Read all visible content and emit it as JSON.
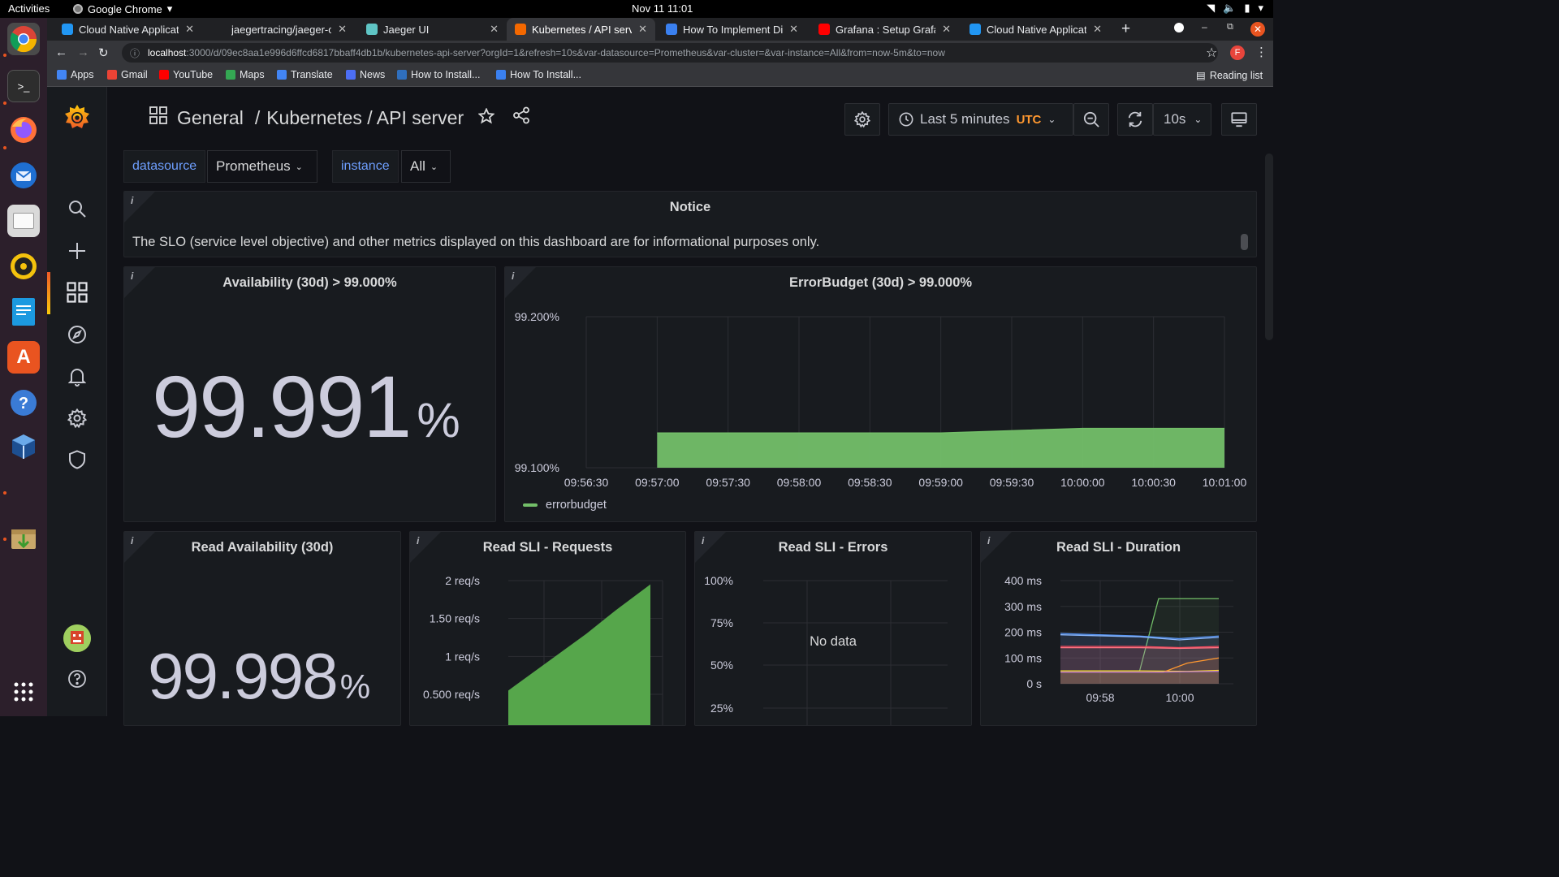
{
  "os": {
    "activities": "Activities",
    "app_name": "Google Chrome",
    "clock": "Nov 11  11:01"
  },
  "browser": {
    "tabs": [
      {
        "title": "Cloud Native Applicatio",
        "favicon_color": "#2196f3"
      },
      {
        "title": "jaegertracing/jaeger-op",
        "favicon_color": "#202124"
      },
      {
        "title": "Jaeger UI",
        "favicon_color": "#5fc5c5"
      },
      {
        "title": "Kubernetes / API server",
        "favicon_color": "#f46800",
        "active": true
      },
      {
        "title": "How To Implement Dist",
        "favicon_color": "#3a80f0"
      },
      {
        "title": "Grafana : Setup Grafana",
        "favicon_color": "#ff0000"
      },
      {
        "title": "Cloud Native Applicatio",
        "favicon_color": "#2196f3"
      }
    ],
    "url_host": "localhost",
    "url_rest": ":3000/d/09ec8aa1e996d6ffcd6817bbaff4db1b/kubernetes-api-server?orgId=1&refresh=10s&var-datasource=Prometheus&var-cluster=&var-instance=All&from=now-5m&to=now",
    "profile_initial": "F",
    "bookmarks": [
      {
        "label": "Apps",
        "color": "#4285f4"
      },
      {
        "label": "Gmail",
        "color": "#ea4335"
      },
      {
        "label": "YouTube",
        "color": "#ff0000"
      },
      {
        "label": "Maps",
        "color": "#34a853"
      },
      {
        "label": "Translate",
        "color": "#4285f4"
      },
      {
        "label": "News",
        "color": "#4c6ef5"
      },
      {
        "label": "How to Install...",
        "color": "#2f6fbe"
      },
      {
        "label": "How To Install...",
        "color": "#3a80f0"
      }
    ],
    "reading_list": "Reading list"
  },
  "dashboard": {
    "breadcrumb": {
      "folder": "General",
      "sep": "/",
      "title": "Kubernetes / API server"
    },
    "time_range": "Last 5 minutes",
    "timezone": "UTC",
    "refresh": "10s",
    "variables": [
      {
        "label": "datasource",
        "value": "Prometheus"
      },
      {
        "label": "instance",
        "value": "All"
      }
    ],
    "notice": {
      "title": "Notice",
      "text": "The SLO (service level objective) and other metrics displayed on this dashboard are for informational purposes only."
    },
    "availability": {
      "title": "Availability (30d) > 99.000%",
      "value": "99.991",
      "unit": "%"
    },
    "read_availability": {
      "title": "Read Availability (30d)",
      "value": "99.998",
      "unit": "%"
    },
    "read_sli_errors": {
      "title": "Read SLI - Errors",
      "no_data": "No data"
    }
  },
  "chart_data": [
    {
      "type": "area",
      "title": "ErrorBudget (30d) > 99.000%",
      "x": [
        "09:56:30",
        "09:57:00",
        "09:57:30",
        "09:58:00",
        "09:58:30",
        "09:59:00",
        "09:59:30",
        "10:00:00",
        "10:00:30",
        "10:01:00"
      ],
      "y_ticks": [
        "99.100%",
        "99.200%"
      ],
      "ylim": [
        99.1,
        99.2
      ],
      "series": [
        {
          "name": "errorbudget",
          "color": "#73bf69",
          "points": [
            [
              "09:57:00",
              99.123
            ],
            [
              "09:58:00",
              99.123
            ],
            [
              "09:59:00",
              99.123
            ],
            [
              "10:00:00",
              99.126
            ],
            [
              "10:01:00",
              99.126
            ]
          ]
        }
      ],
      "grid": true,
      "legend": "bottom-left"
    },
    {
      "type": "area",
      "title": "Read SLI - Requests",
      "y_ticks": [
        "0.500 req/s",
        "1 req/s",
        "1.50 req/s",
        "2 req/s"
      ],
      "ylim": [
        0,
        2
      ],
      "series": [
        {
          "color": "#56a64b",
          "points": [
            [
              0.0,
              0.55
            ],
            [
              0.55,
              1.3
            ],
            [
              0.75,
              1.6
            ],
            [
              1.0,
              1.95
            ]
          ]
        }
      ],
      "grid": true
    },
    {
      "type": "line",
      "title": "Read SLI - Errors",
      "y_ticks": [
        "25%",
        "50%",
        "75%",
        "100%"
      ],
      "ylim": [
        0,
        100
      ],
      "series": [],
      "grid": true
    },
    {
      "type": "line",
      "title": "Read SLI - Duration",
      "x_ticks": [
        "09:58",
        "10:00"
      ],
      "y_ticks": [
        "0 s",
        "100 ms",
        "200 ms",
        "300 ms",
        "400 ms"
      ],
      "ylim": [
        0,
        400
      ],
      "series": [
        {
          "color": "#73bf69",
          "points": [
            [
              0.0,
              50
            ],
            [
              0.5,
              50
            ],
            [
              0.62,
              330
            ],
            [
              1.0,
              330
            ]
          ]
        },
        {
          "color": "#5794f2",
          "points": [
            [
              0.0,
              195
            ],
            [
              0.5,
              185
            ],
            [
              0.75,
              175
            ],
            [
              1.0,
              185
            ]
          ]
        },
        {
          "color": "#8ab8ff",
          "points": [
            [
              0.0,
              190
            ],
            [
              0.5,
              182
            ],
            [
              0.75,
              170
            ],
            [
              1.0,
              180
            ]
          ]
        },
        {
          "color": "#f2495c",
          "points": [
            [
              0.0,
              145
            ],
            [
              0.5,
              145
            ],
            [
              0.75,
              140
            ],
            [
              1.0,
              145
            ]
          ]
        },
        {
          "color": "#ff7383",
          "points": [
            [
              0.0,
              140
            ],
            [
              0.5,
              140
            ],
            [
              0.75,
              137
            ],
            [
              1.0,
              140
            ]
          ]
        },
        {
          "color": "#fade2a",
          "points": [
            [
              0.0,
              50
            ],
            [
              0.5,
              50
            ],
            [
              0.8,
              48
            ],
            [
              1.0,
              52
            ]
          ]
        },
        {
          "color": "#ff9830",
          "points": [
            [
              0.0,
              45
            ],
            [
              0.65,
              45
            ],
            [
              0.8,
              80
            ],
            [
              1.0,
              100
            ]
          ]
        },
        {
          "color": "#b877d9",
          "points": [
            [
              0.0,
              45
            ],
            [
              0.6,
              45
            ],
            [
              1.0,
              48
            ]
          ]
        }
      ],
      "grid": true
    }
  ]
}
